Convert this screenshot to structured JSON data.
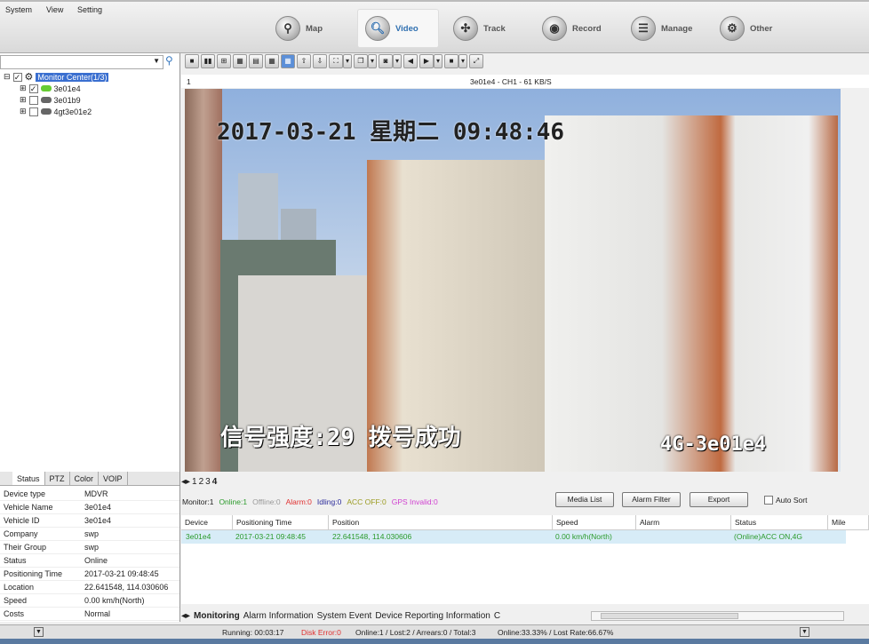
{
  "menu": [
    "System",
    "View",
    "Setting"
  ],
  "nav": [
    {
      "label": "Map",
      "icon": "map-icon"
    },
    {
      "label": "Video",
      "icon": "search-icon"
    },
    {
      "label": "Track",
      "icon": "track-icon"
    },
    {
      "label": "Record",
      "icon": "record-icon"
    },
    {
      "label": "Manage",
      "icon": "manage-icon"
    },
    {
      "label": "Other",
      "icon": "gear-icon"
    }
  ],
  "tree": {
    "root": "Monitor Center(1/3)",
    "devices": [
      "3e01e4",
      "3e01b9",
      "4gt3e01e2"
    ]
  },
  "left_tabs": [
    "Status",
    "PTZ",
    "Color",
    "VOIP"
  ],
  "props": [
    [
      "Device type",
      "MDVR"
    ],
    [
      "Vehicle Name",
      "3e01e4"
    ],
    [
      "Vehicle ID",
      "3e01e4"
    ],
    [
      "Company",
      "swp"
    ],
    [
      "Their Group",
      "swp"
    ],
    [
      "Status",
      "Online"
    ],
    [
      "Positioning Time",
      "2017-03-21 09:48:45"
    ],
    [
      "Location",
      "22.641548, 114.030606"
    ],
    [
      "Speed",
      "0.00 km/h(North)"
    ],
    [
      "Costs",
      "Normal"
    ]
  ],
  "video": {
    "index": "1",
    "title": "3e01e4 - CH1 - 61 KB/S",
    "osd_time": "2017-03-21 星期二 09:48:46",
    "osd_signal": "信号强度:29 拨号成功",
    "osd_name": "4G-3e01e4"
  },
  "screen_tabs": [
    "1",
    "2",
    "3",
    "4"
  ],
  "stats": {
    "monitor": "Monitor:1",
    "online": "Online:1",
    "offline": "Offline:0",
    "alarm": "Alarm:0",
    "idling": "Idling:0",
    "acc_off": "ACC OFF:0",
    "gps_invalid": "GPS Invalid:0"
  },
  "buttons": {
    "media_list": "Media List",
    "alarm_filter": "Alarm Filter",
    "export": "Export",
    "auto_sort": "Auto Sort"
  },
  "table": {
    "headers": [
      "Device",
      "Positioning Time",
      "Position",
      "Speed",
      "Alarm",
      "Status",
      "Mile"
    ],
    "rows": [
      [
        "3e01e4",
        "2017-03-21 09:48:45",
        "22.641548, 114.030606",
        "0.00 km/h(North)",
        "",
        "(Online)ACC ON,4G"
      ]
    ]
  },
  "bottom_tabs": [
    "Monitoring",
    "Alarm Information",
    "System Event",
    "Device Reporting Information",
    "C"
  ],
  "status": {
    "running": "Running: 00:03:17",
    "disk_error": "Disk Error:0",
    "counts": "Online:1 / Lost:2 / Arrears:0 / Total:3",
    "rates": "Online:33.33% / Lost Rate:66.67%"
  },
  "colors": {
    "online": "#2a9a2a",
    "alarm": "#e03030",
    "idling": "#2a2a9a",
    "acc_off": "#9a9a20",
    "gps_invalid": "#d040d0",
    "selected": "#3a6fd0",
    "row_bg": "#d7ecf7"
  }
}
